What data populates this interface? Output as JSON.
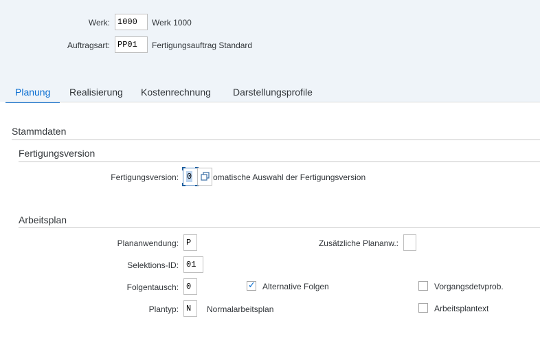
{
  "header": {
    "werk": {
      "label": "Werk:",
      "value": "1000",
      "description": "Werk 1000"
    },
    "auftragsart": {
      "label": "Auftragsart:",
      "value": "PP01",
      "description": "Fertigungsauftrag Standard"
    }
  },
  "tabs": [
    {
      "label": "Planung",
      "active": true
    },
    {
      "label": "Realisierung",
      "active": false
    },
    {
      "label": "Kostenrechnung",
      "active": false
    },
    {
      "label": "Darstellungsprofile",
      "active": false
    }
  ],
  "stammdaten": {
    "title": "Stammdaten",
    "fertigungsversion_group": {
      "title": "Fertigungsversion",
      "field": {
        "label": "Fertigungsversion:",
        "value": "0",
        "description": "omatische Auswahl der Fertigungsversion"
      }
    },
    "arbeitsplan_group": {
      "title": "Arbeitsplan",
      "plananwendung": {
        "label": "Plananwendung:",
        "value": "P"
      },
      "zusaetzliche_plananw": {
        "label": "Zusätzliche Plananw.:",
        "value": ""
      },
      "selektions_id": {
        "label": "Selektions-ID:",
        "value": "01"
      },
      "folgentausch": {
        "label": "Folgentausch:",
        "value": "0"
      },
      "alternative_folgen": {
        "label": "Alternative Folgen",
        "checked": true
      },
      "vorgangsdetvprob": {
        "label": "Vorgangsdetvprob.",
        "checked": false
      },
      "plantyp": {
        "label": "Plantyp:",
        "value": "N",
        "description": "Normalarbeitsplan"
      },
      "arbeitsplantext": {
        "label": "Arbeitsplantext",
        "checked": false
      }
    }
  },
  "colors": {
    "accent": "#0a6ed1",
    "header_bg": "#eff4f9",
    "text": "#32363a"
  }
}
